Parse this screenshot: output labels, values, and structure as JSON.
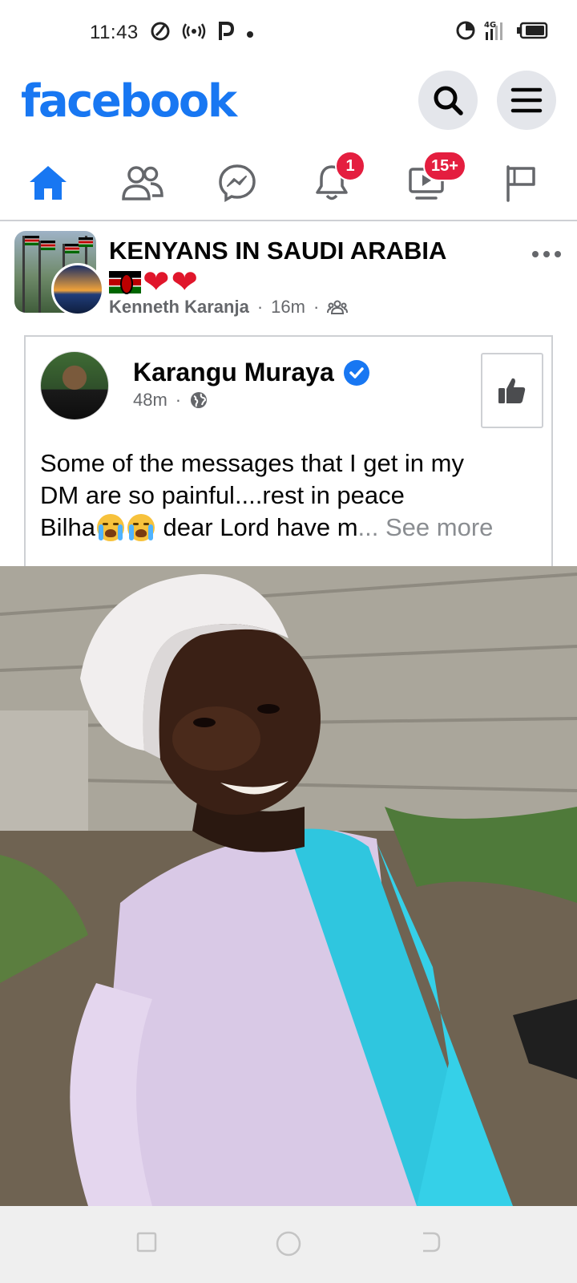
{
  "status_bar": {
    "time": "11:43",
    "network": "4G",
    "icons": [
      "alarm-icon",
      "hotspot-icon",
      "p-app-icon",
      "dot-icon",
      "data-saver-icon",
      "signal-icon",
      "battery-icon"
    ]
  },
  "header": {
    "logo": "facebook",
    "brand_color": "#1877f2"
  },
  "nav": {
    "items": [
      {
        "name": "home",
        "icon": "home-icon",
        "active": true
      },
      {
        "name": "friends",
        "icon": "friends-icon"
      },
      {
        "name": "messenger",
        "icon": "messenger-icon"
      },
      {
        "name": "notifications",
        "icon": "bell-icon",
        "badge": "1"
      },
      {
        "name": "watch",
        "icon": "video-icon",
        "badge": "15+"
      },
      {
        "name": "pages",
        "icon": "flag-icon"
      }
    ]
  },
  "post": {
    "group_name": "KENYANS IN SAUDI ARABIA",
    "author": "Kenneth Karanja",
    "time": "16m",
    "separator": "·",
    "shared": {
      "name": "Karangu Muraya",
      "time": "48m",
      "text_line1": "Some of the messages that I get in my",
      "text_line2": "DM are so painful....rest in peace",
      "text_line3_start": "Bilha",
      "text_line3_end": " dear Lord have m",
      "see_more": "... See more"
    }
  }
}
